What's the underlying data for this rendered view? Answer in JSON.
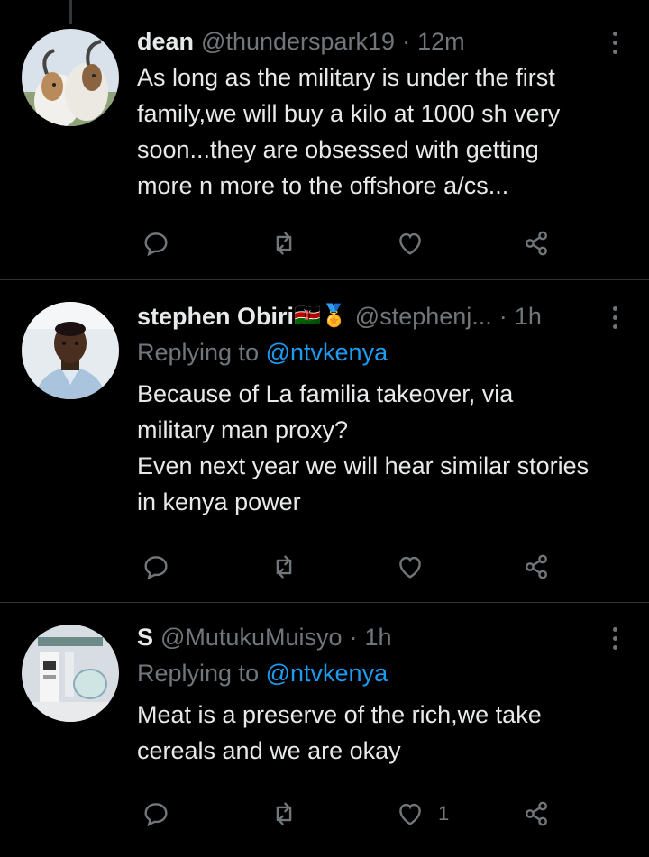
{
  "tweets": [
    {
      "display_name": "dean",
      "handle": "@thunderspark19",
      "dot": "·",
      "time": "12m",
      "replying_prefix": "",
      "replying_to": "",
      "text": "As long as the military is under the first family,we will buy a kilo at 1000 sh very soon...they are obsessed with getting more n more to the offshore a/cs...",
      "like_count": ""
    },
    {
      "display_name": "stephen Obiri",
      "name_emojis": "🇰🇪🏅",
      "handle": "@stephenj...",
      "dot": "·",
      "time": "1h",
      "replying_prefix": "Replying to",
      "replying_to": "@ntvkenya",
      "text": "Because of La familia takeover, via military man proxy?\nEven next year we will hear similar stories in kenya power",
      "like_count": ""
    },
    {
      "display_name": "S",
      "handle": "@MutukuMuisyo",
      "dot": "·",
      "time": "1h",
      "replying_prefix": "Replying to",
      "replying_to": "@ntvkenya",
      "text": "Meat is a preserve of the rich,we take cereals and we are okay",
      "like_count": "1"
    }
  ],
  "icons": {
    "reply": "reply-icon",
    "retweet": "retweet-icon",
    "like": "heart-icon",
    "share": "share-icon",
    "more": "more-icon"
  },
  "colors": {
    "background": "#000000",
    "text": "#e7e9ea",
    "muted": "#71767b",
    "link": "#1d9bf0",
    "divider": "#2f3336"
  }
}
